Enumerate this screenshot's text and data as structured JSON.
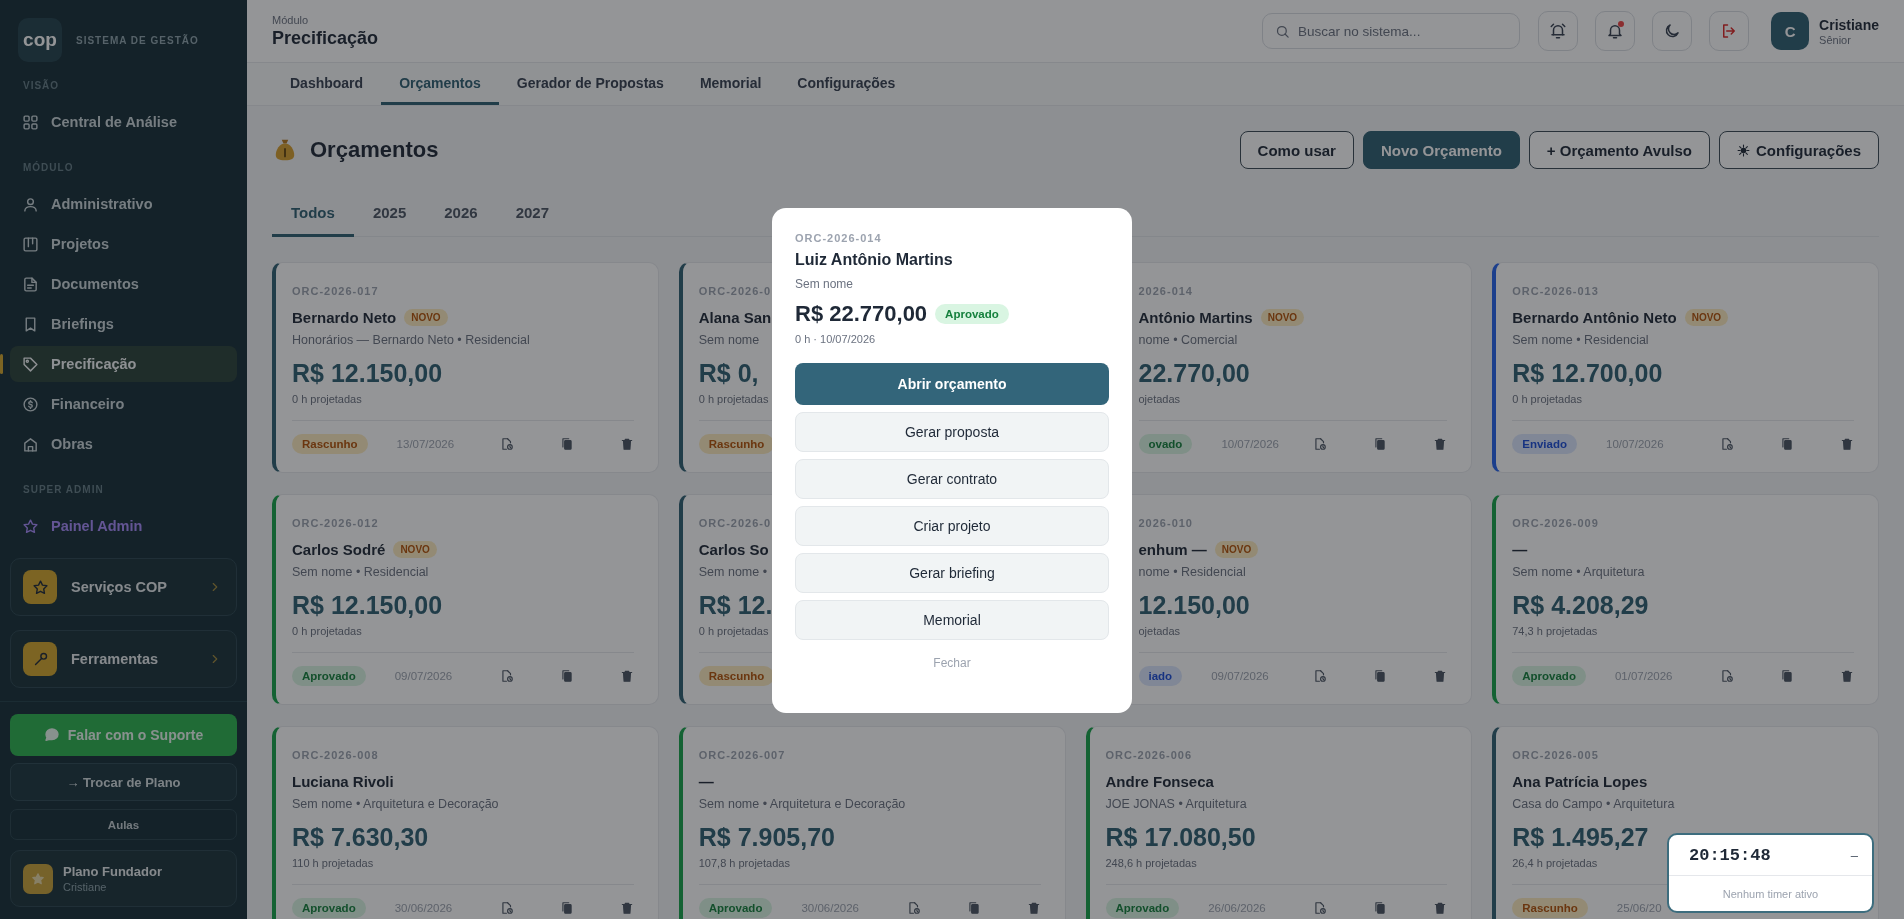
{
  "sidebar": {
    "brand": {
      "logo": "cop",
      "title": "SISTEMA DE GESTÃO"
    },
    "sections": [
      {
        "label": "VISÃO",
        "kind": "default",
        "items": [
          {
            "label": "Central de Análise",
            "selected": false
          }
        ]
      },
      {
        "label": "MÓDULO",
        "kind": "default",
        "items": [
          {
            "label": "Administrativo",
            "selected": false
          },
          {
            "label": "Projetos",
            "selected": false
          },
          {
            "label": "Documentos",
            "selected": false
          },
          {
            "label": "Briefings",
            "selected": false
          },
          {
            "label": "Precificação",
            "selected": true
          },
          {
            "label": "Financeiro",
            "selected": false
          },
          {
            "label": "Obras",
            "selected": false
          }
        ]
      },
      {
        "label": "SUPER ADMIN",
        "kind": "admin",
        "items": [
          {
            "label": "Painel Admin",
            "selected": false
          }
        ]
      }
    ],
    "shortcuts": [
      {
        "label": "Serviços COP"
      },
      {
        "label": "Ferramentas"
      }
    ],
    "support_button": "Falar com o Suporte",
    "plan_button": "→ Trocar de Plano",
    "lessons_button": "Aulas",
    "plan": {
      "name": "Plano Fundador",
      "user": "Cristiane"
    }
  },
  "header": {
    "module_label": "Módulo",
    "module_title": "Precificação",
    "search": {
      "placeholder": "Buscar no sistema..."
    },
    "alerts_unread": true,
    "user": {
      "initial": "C",
      "name": "Cristiane",
      "role": "Sênior"
    }
  },
  "tabs": [
    {
      "label": "Dashboard",
      "selected": false
    },
    {
      "label": "Orçamentos",
      "selected": true
    },
    {
      "label": "Gerador de Propostas",
      "selected": false
    },
    {
      "label": "Memorial",
      "selected": false
    },
    {
      "label": "Configurações",
      "selected": false
    }
  ],
  "page": {
    "title": "Orçamentos",
    "buttons": [
      {
        "label": "Como usar",
        "kind": "outline"
      },
      {
        "label": "Novo Orçamento",
        "kind": "primary"
      },
      {
        "label": "+ Orçamento Avulso",
        "kind": "outline"
      },
      {
        "label": "Configurações",
        "kind": "settings"
      }
    ],
    "year_tabs": [
      {
        "label": "Todos",
        "selected": true
      },
      {
        "label": "2025",
        "selected": false
      },
      {
        "label": "2026",
        "selected": false
      },
      {
        "label": "2027",
        "selected": false
      }
    ],
    "cards": [
      {
        "code": "ORC-2026-017",
        "name": "Bernardo Neto",
        "badge": "NOVO",
        "subtitle": "Honorários — Bernardo Neto • Residencial",
        "value": "R$ 12.150,00",
        "hours": "0 h projetadas",
        "status": {
          "label": "Rascunho",
          "kind": "draft"
        },
        "date": "13/07/2026"
      },
      {
        "code": "ORC-2026-0",
        "name": "Alana San",
        "subtitle": "Sem nome",
        "value": "R$ 0,",
        "hours": "0 h projetadas",
        "status": {
          "label": "Rascunho",
          "kind": "draft"
        }
      },
      {
        "code": "2026-014",
        "name": "Antônio Martins",
        "badge": "NOVO",
        "subtitle": "nome • Comercial",
        "value": "22.770,00",
        "hours": "ojetadas",
        "status": {
          "label": "ovado",
          "kind": "approved"
        },
        "date": "10/07/2026"
      },
      {
        "code": "ORC-2026-013",
        "name": "Bernardo Antônio Neto",
        "badge": "NOVO",
        "subtitle": "Sem nome • Residencial",
        "value": "R$ 12.700,00",
        "hours": "0 h projetadas",
        "status": {
          "label": "Enviado",
          "kind": "sent"
        },
        "date": "10/07/2026"
      },
      {
        "code": "ORC-2026-012",
        "name": "Carlos Sodré",
        "badge": "NOVO",
        "subtitle": "Sem nome • Residencial",
        "value": "R$ 12.150,00",
        "hours": "0 h projetadas",
        "status": {
          "label": "Aprovado",
          "kind": "approved"
        },
        "date": "09/07/2026"
      },
      {
        "code": "ORC-2026-0",
        "name": "Carlos So",
        "subtitle": "Sem nome •",
        "value": "R$ 12.",
        "hours": "0 h projetadas",
        "status": {
          "label": "Rascunho",
          "kind": "draft"
        }
      },
      {
        "code": "2026-010",
        "name": "enhum —",
        "badge": "NOVO",
        "subtitle": "nome • Residencial",
        "value": "12.150,00",
        "hours": "ojetadas",
        "status": {
          "label": "iado",
          "kind": "sent"
        },
        "date": "09/07/2026"
      },
      {
        "code": "ORC-2026-009",
        "name": "—",
        "subtitle": "Sem nome • Arquitetura",
        "value": "R$ 4.208,29",
        "hours": "74,3 h projetadas",
        "status": {
          "label": "Aprovado",
          "kind": "approved"
        },
        "date": "01/07/2026"
      },
      {
        "code": "ORC-2026-008",
        "name": "Luciana Rivoli",
        "subtitle": "Sem nome • Arquitetura e Decoração",
        "value": "R$ 7.630,30",
        "hours": "110 h projetadas",
        "status": {
          "label": "Aprovado",
          "kind": "approved"
        },
        "date": "30/06/2026"
      },
      {
        "code": "ORC-2026-007",
        "name": "—",
        "subtitle": "Sem nome • Arquitetura e Decoração",
        "value": "R$ 7.905,70",
        "hours": "107,8 h projetadas",
        "status": {
          "label": "Aprovado",
          "kind": "approved"
        },
        "date": "30/06/2026"
      },
      {
        "code": "ORC-2026-006",
        "name": "Andre Fonseca",
        "subtitle": "JOE JONAS • Arquitetura",
        "value": "R$ 17.080,50",
        "hours": "248,6 h projetadas",
        "status": {
          "label": "Aprovado",
          "kind": "approved"
        },
        "date": "26/06/2026"
      },
      {
        "code": "ORC-2026-005",
        "name": "Ana Patrícia Lopes",
        "subtitle": "Casa do Campo • Arquitetura",
        "value": "R$ 1.495,27",
        "hours": "26,4 h projetadas",
        "status": {
          "label": "Rascunho",
          "kind": "draft"
        },
        "date": "25/06/20"
      }
    ]
  },
  "modal": {
    "code": "ORC-2026-014",
    "name": "Luiz Antônio Martins",
    "subtitle": "Sem nome",
    "value": "R$ 22.770,00",
    "status": {
      "label": "Aprovado",
      "kind": "approved"
    },
    "meta": "0 h · 10/07/2026",
    "actions": [
      {
        "label": "Abrir orçamento",
        "kind": "primary"
      },
      {
        "label": "Gerar proposta",
        "kind": "secondary"
      },
      {
        "label": "Gerar contrato",
        "kind": "secondary"
      },
      {
        "label": "Criar projeto",
        "kind": "secondary"
      },
      {
        "label": "Gerar briefing",
        "kind": "secondary"
      },
      {
        "label": "Memorial",
        "kind": "secondary"
      }
    ],
    "close": "Fechar"
  },
  "timer": {
    "time": "20:15:48",
    "minimize": "–",
    "status": "Nenhum timer ativo"
  }
}
